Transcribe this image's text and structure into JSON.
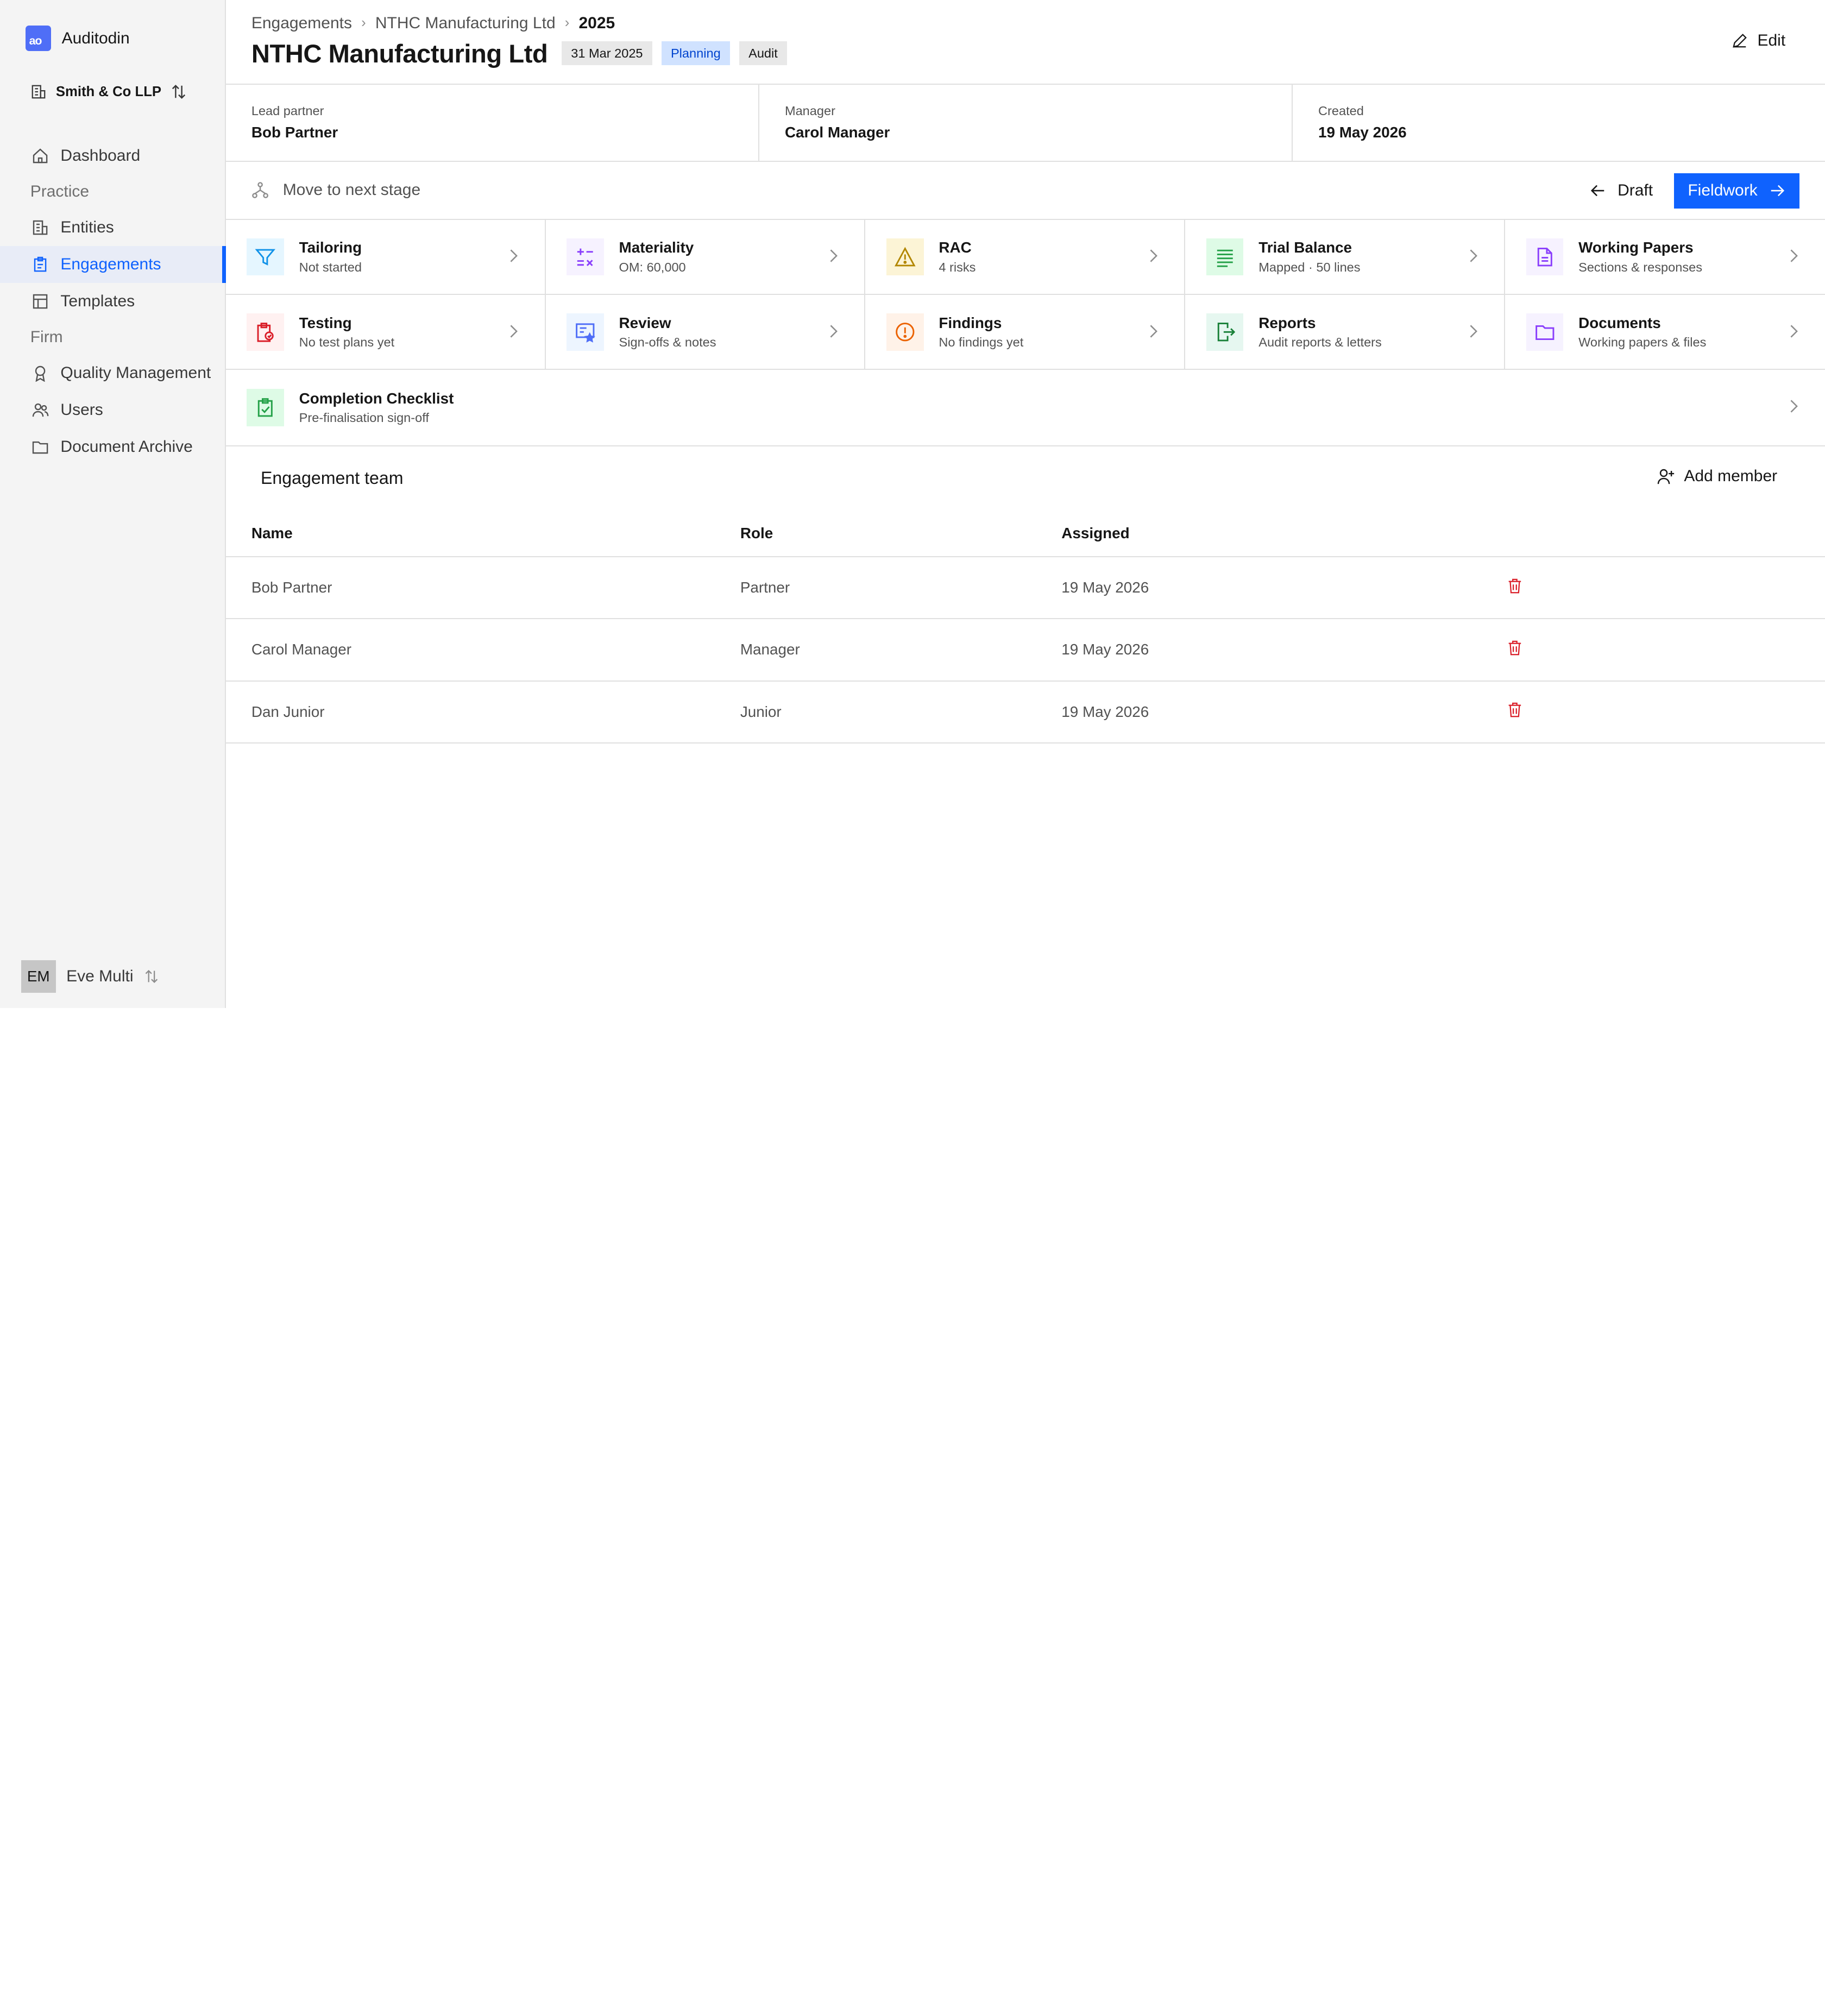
{
  "app": {
    "name": "Auditodin",
    "logo_text": "ao"
  },
  "org": {
    "name": "Smith & Co LLP"
  },
  "nav": {
    "dashboard": "Dashboard",
    "practice_group": "Practice",
    "entities": "Entities",
    "engagements": "Engagements",
    "templates": "Templates",
    "firm_group": "Firm",
    "quality_management": "Quality Management",
    "users": "Users",
    "document_archive": "Document Archive"
  },
  "user": {
    "initials": "EM",
    "name": "Eve Multi"
  },
  "breadcrumb": {
    "root": "Engagements",
    "client": "NTHC Manufacturing Ltd",
    "year": "2025"
  },
  "header": {
    "title": "NTHC Manufacturing Ltd",
    "year_end": "31 Mar 2025",
    "stage_tag": "Planning",
    "type_tag": "Audit",
    "edit_label": "Edit"
  },
  "meta": {
    "lead_partner_label": "Lead partner",
    "lead_partner_value": "Bob Partner",
    "manager_label": "Manager",
    "manager_value": "Carol Manager",
    "created_label": "Created",
    "created_value": "19 May 2026"
  },
  "stage_bar": {
    "move_label": "Move to next stage",
    "prev_label": "Draft",
    "next_label": "Fieldwork"
  },
  "tiles": [
    {
      "title": "Tailoring",
      "sub": "Not started"
    },
    {
      "title": "Materiality",
      "sub": "OM: 60,000"
    },
    {
      "title": "RAC",
      "sub": "4 risks"
    },
    {
      "title": "Trial Balance",
      "sub": "Mapped · 50 lines"
    },
    {
      "title": "Working Papers",
      "sub": "Sections & responses"
    },
    {
      "title": "Testing",
      "sub": "No test plans yet"
    },
    {
      "title": "Review",
      "sub": "Sign-offs & notes"
    },
    {
      "title": "Findings",
      "sub": "No findings yet"
    },
    {
      "title": "Reports",
      "sub": "Audit reports & letters"
    },
    {
      "title": "Documents",
      "sub": "Working papers & files"
    },
    {
      "title": "Completion Checklist",
      "sub": "Pre-finalisation sign-off"
    }
  ],
  "team": {
    "title": "Engagement team",
    "add_label": "Add member",
    "columns": {
      "name": "Name",
      "role": "Role",
      "assigned": "Assigned"
    },
    "rows": [
      {
        "name": "Bob Partner",
        "role": "Partner",
        "assigned": "19 May 2026"
      },
      {
        "name": "Carol Manager",
        "role": "Manager",
        "assigned": "19 May 2026"
      },
      {
        "name": "Dan Junior",
        "role": "Junior",
        "assigned": "19 May 2026"
      }
    ]
  },
  "colors": {
    "accent": "#0f62fe",
    "brand": "#4f6ef7",
    "danger": "#da1e28"
  }
}
